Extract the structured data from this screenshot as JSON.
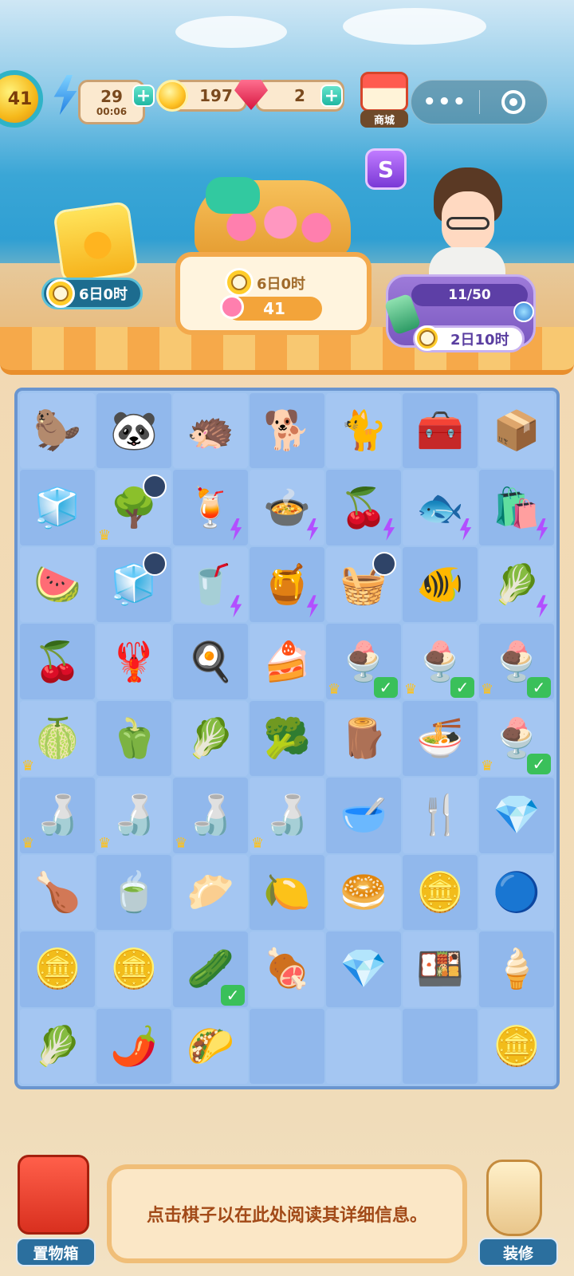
{
  "hud": {
    "level": "41",
    "energy_value": "29",
    "energy_timer": "00:06",
    "coins": "197",
    "gems": "2",
    "shop_label": "商城",
    "menu_more": "•••"
  },
  "events": {
    "ticket_timer": "6日0时",
    "basket_timer": "6日0时",
    "basket_count": "41",
    "order_progress": "11/50",
    "order_timer": "2日10时"
  },
  "board": {
    "cells": [
      {
        "name": "capybara-statue",
        "glyph": "🦫"
      },
      {
        "name": "panda-statue",
        "glyph": "🐼"
      },
      {
        "name": "pangolin-statue",
        "glyph": "🦔"
      },
      {
        "name": "dog-statue",
        "glyph": "🐕"
      },
      {
        "name": "cat-statue",
        "glyph": "🐈"
      },
      {
        "name": "purple-chest",
        "glyph": "🧰"
      },
      {
        "name": "pot-box",
        "glyph": "📦"
      },
      {
        "name": "ice-cube",
        "glyph": "🧊"
      },
      {
        "name": "tree",
        "glyph": "🌳",
        "crown": true,
        "timer": true
      },
      {
        "name": "juicer",
        "glyph": "🍹",
        "bolt": true
      },
      {
        "name": "soup-bowl",
        "glyph": "🍲",
        "bolt": true
      },
      {
        "name": "cherry-pan",
        "glyph": "🍒",
        "bolt": true
      },
      {
        "name": "fish-bag",
        "glyph": "🐟",
        "bolt": true
      },
      {
        "name": "grocery-bag",
        "glyph": "🛍️",
        "bolt": true
      },
      {
        "name": "watermelon",
        "glyph": "🍉"
      },
      {
        "name": "fridge",
        "glyph": "🧊",
        "timer": true
      },
      {
        "name": "blender",
        "glyph": "🥤",
        "bolt": true
      },
      {
        "name": "clay-pot",
        "glyph": "🍯",
        "bolt": true
      },
      {
        "name": "cherry-basket",
        "glyph": "🧺",
        "timer": true
      },
      {
        "name": "fishbowl",
        "glyph": "🐠"
      },
      {
        "name": "vegetable-basket",
        "glyph": "🥬",
        "bolt": true
      },
      {
        "name": "cherries",
        "glyph": "🍒"
      },
      {
        "name": "crayfish-plate",
        "glyph": "🦞"
      },
      {
        "name": "egg-dish",
        "glyph": "🍳"
      },
      {
        "name": "cake-slice",
        "glyph": "🍰"
      },
      {
        "name": "ice-cream-cup",
        "glyph": "🍨",
        "crown": true,
        "check": true
      },
      {
        "name": "ice-cream-cup",
        "glyph": "🍨",
        "crown": true,
        "check": true
      },
      {
        "name": "ice-cream-cup",
        "glyph": "🍨",
        "crown": true,
        "check": true
      },
      {
        "name": "lime",
        "glyph": "🍈",
        "crown": true
      },
      {
        "name": "okra",
        "glyph": "🫑"
      },
      {
        "name": "bok-choy",
        "glyph": "🥬"
      },
      {
        "name": "broccoli",
        "glyph": "🥦"
      },
      {
        "name": "logs",
        "glyph": "🪵"
      },
      {
        "name": "noodle-bowl",
        "glyph": "🍜"
      },
      {
        "name": "ice-cream-cup",
        "glyph": "🍨",
        "crown": true,
        "check": true
      },
      {
        "name": "tea-set",
        "glyph": "🍶",
        "crown": true
      },
      {
        "name": "tea-set",
        "glyph": "🍶",
        "crown": true
      },
      {
        "name": "tea-set",
        "glyph": "🍶",
        "crown": true
      },
      {
        "name": "tea-set",
        "glyph": "🍶",
        "crown": true
      },
      {
        "name": "honey-bowl",
        "glyph": "🥣"
      },
      {
        "name": "spatula",
        "glyph": "🍴"
      },
      {
        "name": "ruby-pile",
        "glyph": "💎"
      },
      {
        "name": "roast-chicken",
        "glyph": "🍗"
      },
      {
        "name": "corn-soup",
        "glyph": "🍵"
      },
      {
        "name": "dumpling-steamer",
        "glyph": "🥟"
      },
      {
        "name": "lemon-drink",
        "glyph": "🍋"
      },
      {
        "name": "steamed-bun",
        "glyph": "🥯"
      },
      {
        "name": "coin-stack",
        "glyph": "🪙"
      },
      {
        "name": "blue-orb",
        "glyph": "🔵"
      },
      {
        "name": "coin-pile",
        "glyph": "🪙"
      },
      {
        "name": "coin-stack",
        "glyph": "🪙"
      },
      {
        "name": "cucumber",
        "glyph": "🥒",
        "check": true
      },
      {
        "name": "roast-duck",
        "glyph": "🍖"
      },
      {
        "name": "ruby",
        "glyph": "💎"
      },
      {
        "name": "bento",
        "glyph": "🍱"
      },
      {
        "name": "soft-serve",
        "glyph": "🍦"
      },
      {
        "name": "cabbage",
        "glyph": "🥬"
      },
      {
        "name": "green-pepper",
        "glyph": "🌶️"
      },
      {
        "name": "taco",
        "glyph": "🌮"
      },
      {
        "name": "empty",
        "glyph": ""
      },
      {
        "name": "empty",
        "glyph": ""
      },
      {
        "name": "empty",
        "glyph": ""
      },
      {
        "name": "gold-coin",
        "glyph": "🪙"
      }
    ]
  },
  "bottom": {
    "storage_label": "置物箱",
    "info_text": "点击棋子以在此处阅读其详细信息。",
    "decorate_label": "装修"
  }
}
